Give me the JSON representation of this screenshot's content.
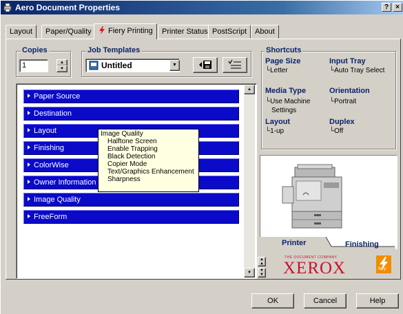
{
  "window": {
    "title": "Aero Document Properties",
    "help_label": "?",
    "close_label": "×"
  },
  "tabs": [
    {
      "label": "Layout"
    },
    {
      "label": "Paper/Quality"
    },
    {
      "label": "Fiery Printing"
    },
    {
      "label": "Printer Status"
    },
    {
      "label": "PostScript"
    },
    {
      "label": "About"
    }
  ],
  "copies": {
    "label": "Copies",
    "value": "1"
  },
  "job_templates": {
    "label": "Job Templates",
    "selected": "Untitled"
  },
  "sections": [
    {
      "label": "Paper Source"
    },
    {
      "label": "Destination"
    },
    {
      "label": "Layout"
    },
    {
      "label": "Finishing"
    },
    {
      "label": "ColorWise"
    },
    {
      "label": "Owner Information"
    },
    {
      "label": "Image Quality"
    },
    {
      "label": "FreeForm"
    }
  ],
  "tooltip": {
    "title": "Image Quality",
    "items": [
      "Halftone Screen",
      "Enable Trapping",
      "Black Detection",
      "Copier Mode",
      "Text/Graphics Enhancement",
      "Sharpness"
    ]
  },
  "shortcuts": {
    "label": "Shortcuts",
    "page_size": {
      "title": "Page Size",
      "value": "Letter"
    },
    "input_tray": {
      "title": "Input Tray",
      "value": "Auto Tray Select"
    },
    "media_type": {
      "title": "Media Type",
      "value_line1": "Use Machine",
      "value_line2": "Settings"
    },
    "orientation": {
      "title": "Orientation",
      "value": "Portrait"
    },
    "layout": {
      "title": "Layout",
      "value": "1-up"
    },
    "duplex": {
      "title": "Duplex",
      "value": "Off"
    }
  },
  "printer_view": {
    "tab_printer": "Printer",
    "tab_finishing": "Finishing"
  },
  "branding": {
    "tagline": "THE DOCUMENT COMPANY",
    "brand": "XEROX",
    "fiery": "fiery",
    "brand_color": "#c8102e",
    "fiery_color": "#e85a0c"
  },
  "buttons": {
    "ok": "OK",
    "cancel": "Cancel",
    "help": "Help"
  },
  "colors": {
    "accent_blue": "#0a246a",
    "section_blue": "#0a0ac8"
  }
}
